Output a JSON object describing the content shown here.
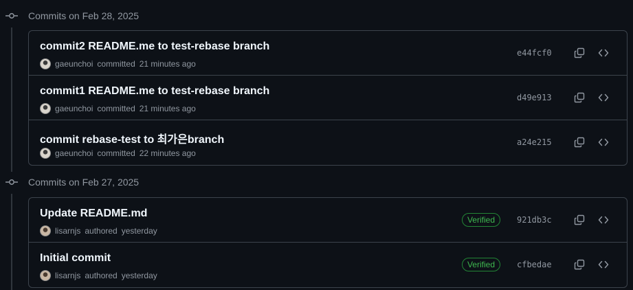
{
  "groups": [
    {
      "title": "Commits on Feb 28, 2025",
      "commits": [
        {
          "message": "commit2 README.me to test-rebase branch",
          "author": "gaeunchoi",
          "action": "committed",
          "time": "21 minutes ago",
          "verified": "",
          "sha": "e44fcf0"
        },
        {
          "message": "commit1 README.me to test-rebase branch",
          "author": "gaeunchoi",
          "action": "committed",
          "time": "21 minutes ago",
          "verified": "",
          "sha": "d49e913"
        },
        {
          "message": "commit rebase-test to 최가은branch",
          "author": "gaeunchoi",
          "action": "committed",
          "time": "22 minutes ago",
          "verified": "",
          "sha": "a24e215"
        }
      ]
    },
    {
      "title": "Commits on Feb 27, 2025",
      "commits": [
        {
          "message": "Update README.md",
          "author": "lisarnjs",
          "action": "authored",
          "time": "yesterday",
          "verified": "Verified",
          "sha": "921db3c"
        },
        {
          "message": "Initial commit",
          "author": "lisarnjs",
          "action": "authored",
          "time": "yesterday",
          "verified": "Verified",
          "sha": "cfbedae"
        }
      ]
    }
  ],
  "icons": {
    "node": "git-commit-icon",
    "copy": "copy-icon",
    "browse": "code-icon",
    "avatar": "avatar"
  },
  "colors": {
    "background": "#0d1117",
    "border": "#3d444d",
    "text": "#f0f6fc",
    "muted": "#9198a1",
    "verified": "#3fb950"
  }
}
